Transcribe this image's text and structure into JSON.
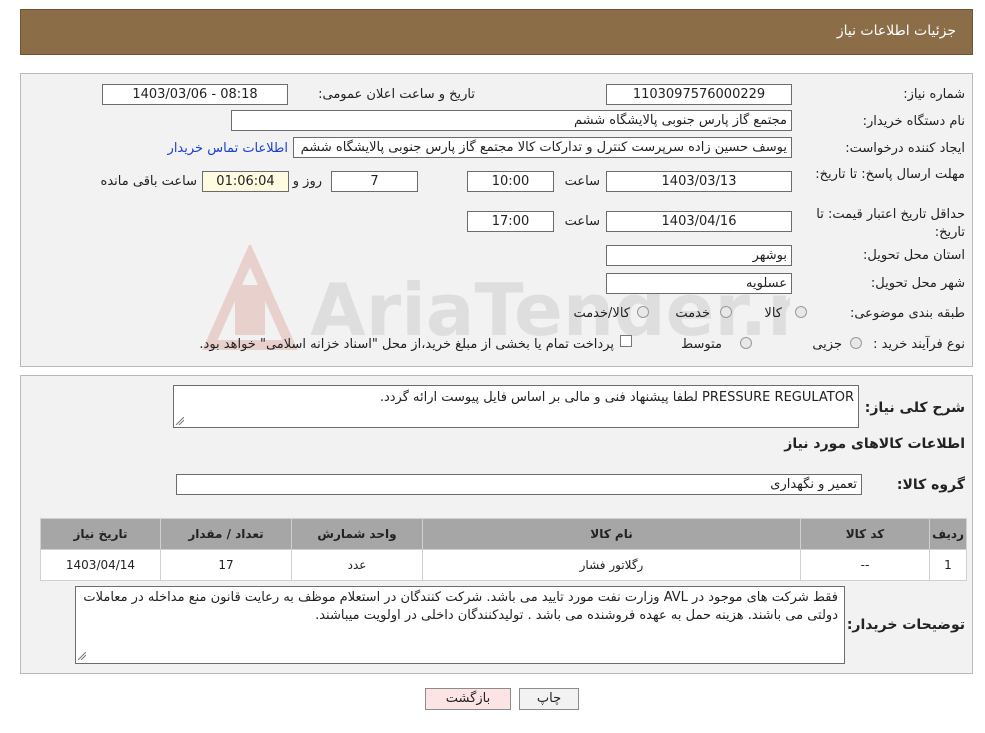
{
  "header": {
    "title": "جزئیات اطلاعات نیاز"
  },
  "form": {
    "need_number_label": "شماره نیاز:",
    "need_number": "1103097576000229",
    "announce_label": "تاریخ و ساعت اعلان عمومی:",
    "announce_value": "1403/03/06 - 08:18",
    "buyer_org_label": "نام دستگاه خریدار:",
    "buyer_org": "مجتمع گاز پارس جنوبی  پالایشگاه ششم",
    "creator_label": "ایجاد کننده درخواست:",
    "creator": "یوسف حسین زاده سرپرست کنترل و تدارکات کالا مجتمع گاز پارس جنوبی  پالایشگاه ششم",
    "contact_link": "اطلاعات تماس خریدار",
    "deadline_label": "مهلت ارسال پاسخ: تا تاریخ:",
    "deadline_date": "1403/03/13",
    "time_label": "ساعت",
    "deadline_time": "10:00",
    "days_value": "7",
    "days_label": "روز و",
    "remaining_time": "01:06:04",
    "remaining_label": "ساعت باقی مانده",
    "price_valid_label": "حداقل تاریخ اعتبار قیمت: تا تاریخ:",
    "price_valid_date": "1403/04/16",
    "price_valid_time": "17:00",
    "province_label": "استان محل تحویل:",
    "province": "بوشهر",
    "city_label": "شهر محل تحویل:",
    "city": "عسلویه",
    "category_label": "طبقه بندی موضوعی:",
    "category_options": [
      "کالا",
      "خدمت",
      "کالا/خدمت"
    ],
    "process_label": "نوع فرآیند خرید :",
    "process_options": [
      "جزیی",
      "متوسط"
    ],
    "process_note": "پرداخت تمام یا بخشی از مبلغ خرید،از محل \"اسناد خزانه اسلامی\" خواهد بود."
  },
  "details": {
    "desc_label": "شرح کلی نیاز:",
    "desc_value": "PRESSURE REGULATOR لطفا پیشنهاد فنی و مالی بر اساس فایل پیوست ارائه گردد.",
    "items_title": "اطلاعات کالاهای مورد نیاز",
    "group_label": "گروه کالا:",
    "group_value": "تعمیر و نگهداری",
    "table": {
      "headers": [
        "ردیف",
        "کد کالا",
        "نام کالا",
        "واحد شمارش",
        "تعداد / مقدار",
        "تاریخ نیاز"
      ],
      "rows": [
        [
          "1",
          "--",
          "رگلاتور فشار",
          "عدد",
          "17",
          "1403/04/14"
        ]
      ]
    },
    "buyer_notes_label": "توضیحات خریدار:",
    "buyer_notes": "فقط شرکت های موجود در AVL وزارت نفت مورد تایید می باشد. شرکت کنندگان در استعلام موظف به رعایت قانون منع مداخله در معاملات دولتی می باشند. هزینه حمل به عهده فروشنده می باشد . تولیدکنندگان داخلی در اولویت میباشند."
  },
  "buttons": {
    "print": "چاپ",
    "back": "بازگشت"
  },
  "watermark": {
    "text": "AriaTender.neT"
  },
  "colors": {
    "header_bg": "#8b6d47",
    "link": "#1a3fd6",
    "back_btn_bg": "#fde4e4"
  }
}
